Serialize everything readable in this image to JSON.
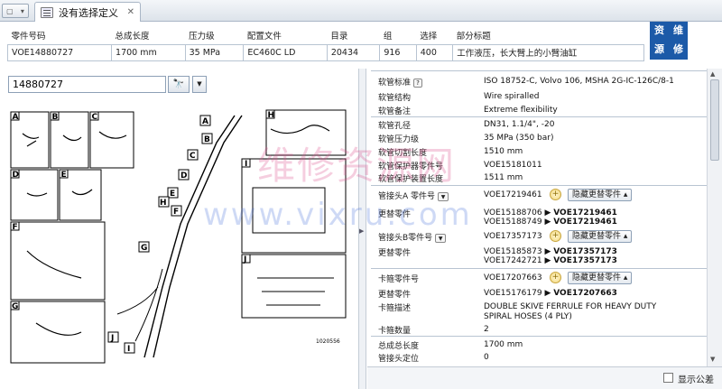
{
  "tab": {
    "title": "没有选择定义",
    "close": "✕"
  },
  "header": {
    "columns": [
      "零件号码",
      "总成长度",
      "压力级",
      "配置文件",
      "目录",
      "组",
      "选择",
      "部分标题"
    ],
    "values": [
      "VOE14880727",
      "1700 mm",
      "35 MPa",
      "EC460C LD",
      "20434",
      "916",
      "400",
      "工作液压，长大臂上的小臂油缸"
    ]
  },
  "logo": [
    "资",
    "维",
    "源",
    "修"
  ],
  "search": {
    "value": "14880727"
  },
  "diagram": {
    "labels": [
      "A",
      "B",
      "C",
      "D",
      "E",
      "F",
      "G",
      "H",
      "I",
      "J"
    ],
    "footer": "1020556"
  },
  "details": {
    "hose_standard": {
      "k": "软管标准",
      "v": "ISO 18752-C, Volvo 106, MSHA 2G-IC-126C/8-1"
    },
    "hose_structure": {
      "k": "软管结构",
      "v": "Wire spiralled"
    },
    "hose_note": {
      "k": "软管备注",
      "v": "Extreme flexibility"
    },
    "hose_bore": {
      "k": "软管孔径",
      "v": "DN31, 1.1/4\", -20"
    },
    "hose_pressure": {
      "k": "软管压力级",
      "v": "35 MPa (350 bar)"
    },
    "hose_cut_length": {
      "k": "软管切割长度",
      "v": "1510 mm"
    },
    "protector_part": {
      "k": "软管保护器零件号",
      "v": "VOE15181011"
    },
    "protector_length": {
      "k": "软管保护装置长度",
      "v": "1511 mm"
    },
    "fitting_a": {
      "k": "管接头A 零件号",
      "v": "VOE17219461",
      "hide": "隐藏更替零件"
    },
    "replace_a": {
      "k": "更替零件",
      "v1": "VOE15188706",
      "t1": "VOE17219461",
      "v2": "VOE15188749",
      "t2": "VOE17219461"
    },
    "fitting_b": {
      "k": "管接头B零件号",
      "v": "VOE17357173",
      "hide": "隐藏更替零件"
    },
    "replace_b": {
      "k": "更替零件",
      "v1": "VOE15185873",
      "t1": "VOE17357173",
      "v2": "VOE17242721",
      "t2": "VOE17357173"
    },
    "clamp_part": {
      "k": "卡箍零件号",
      "v": "VOE17207663",
      "hide": "隐藏更替零件"
    },
    "replace_c": {
      "k": "更替零件",
      "v1": "VOE15176179",
      "t1": "VOE17207663"
    },
    "clamp_desc": {
      "k": "卡箍描述",
      "v1": "DOUBLE SKIVE FERRULE FOR HEAVY DUTY",
      "v2": "SPIRAL HOSES (4 PLY)"
    },
    "clamp_qty": {
      "k": "卡箍数量",
      "v": "2"
    },
    "assembly_length": {
      "k": "总成总长度",
      "v": "1700 mm"
    },
    "fitting_pos": {
      "k": "管接头定位",
      "v": "0"
    }
  },
  "bottom": {
    "show_tolerance": "显示公差"
  },
  "watermark": {
    "line1": "维修资源网",
    "line2": "www.vixru.com"
  }
}
